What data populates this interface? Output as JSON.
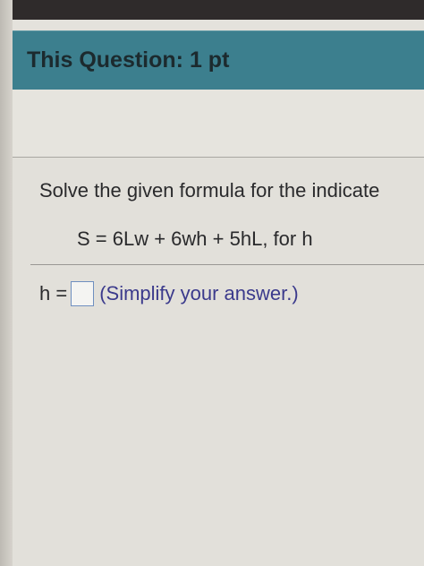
{
  "question_header": {
    "label": "This Question: 1 pt"
  },
  "problem": {
    "prompt": "Solve the given formula for the indicate",
    "formula": "S = 6Lw + 6wh + 5hL, for h",
    "answer": {
      "variable_label": "h =",
      "value": "",
      "hint": "(Simplify your answer.)"
    }
  },
  "colors": {
    "header_bar": "#3c7f8e",
    "hint_text": "#3b3a8c",
    "answer_box_border": "#6f8fc0"
  }
}
